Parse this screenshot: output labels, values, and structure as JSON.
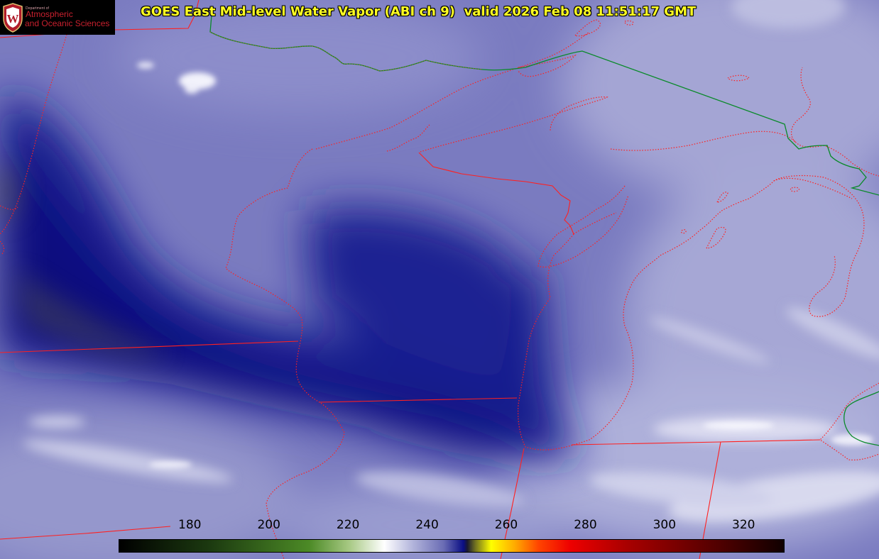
{
  "header": {
    "title": "GOES East Mid-level Water Vapor (ABI ch 9)  valid 2026 Feb 08 11:51:17 GMT"
  },
  "logo": {
    "crest_letter": "W",
    "small_text": "Department of",
    "line1": "Atmospheric",
    "line2": "and Oceanic Sciences",
    "colors": {
      "text": "#c8202e",
      "crest": "#b01c2a"
    }
  },
  "colorbar": {
    "label_min": 180,
    "label_max": 320,
    "ticks": [
      {
        "value": 180,
        "label": "180"
      },
      {
        "value": 200,
        "label": "200"
      },
      {
        "value": 220,
        "label": "220"
      },
      {
        "value": 240,
        "label": "240"
      },
      {
        "value": 260,
        "label": "260"
      },
      {
        "value": 280,
        "label": "280"
      },
      {
        "value": 300,
        "label": "300"
      },
      {
        "value": 320,
        "label": "320"
      }
    ],
    "stops": [
      {
        "value": 162,
        "color": "#000000"
      },
      {
        "value": 185,
        "color": "#1c3a10"
      },
      {
        "value": 210,
        "color": "#4c8a26"
      },
      {
        "value": 220,
        "color": "#a6c882"
      },
      {
        "value": 229,
        "color": "#ffffff"
      },
      {
        "value": 236,
        "color": "#b4b6dc"
      },
      {
        "value": 244,
        "color": "#6a6cb4"
      },
      {
        "value": 249,
        "color": "#0a0e84"
      },
      {
        "value": 250,
        "color": "#1a1a30"
      },
      {
        "value": 252,
        "color": "#707020"
      },
      {
        "value": 256,
        "color": "#ffff00"
      },
      {
        "value": 262,
        "color": "#ffaa00"
      },
      {
        "value": 268,
        "color": "#ff4400"
      },
      {
        "value": 276,
        "color": "#ee0000"
      },
      {
        "value": 290,
        "color": "#aa0000"
      },
      {
        "value": 308,
        "color": "#660000"
      },
      {
        "value": 330,
        "color": "#100000"
      }
    ]
  },
  "map": {
    "colors": {
      "state_borders": "#ff2020",
      "country_border": "#0a8a2a",
      "dry_slot": "#0a0e84",
      "moist_air": "#a8a8d4",
      "clouds": "#f0f0fa"
    },
    "legend_marks": [
      "state-borders",
      "coastlines",
      "international-border"
    ]
  }
}
